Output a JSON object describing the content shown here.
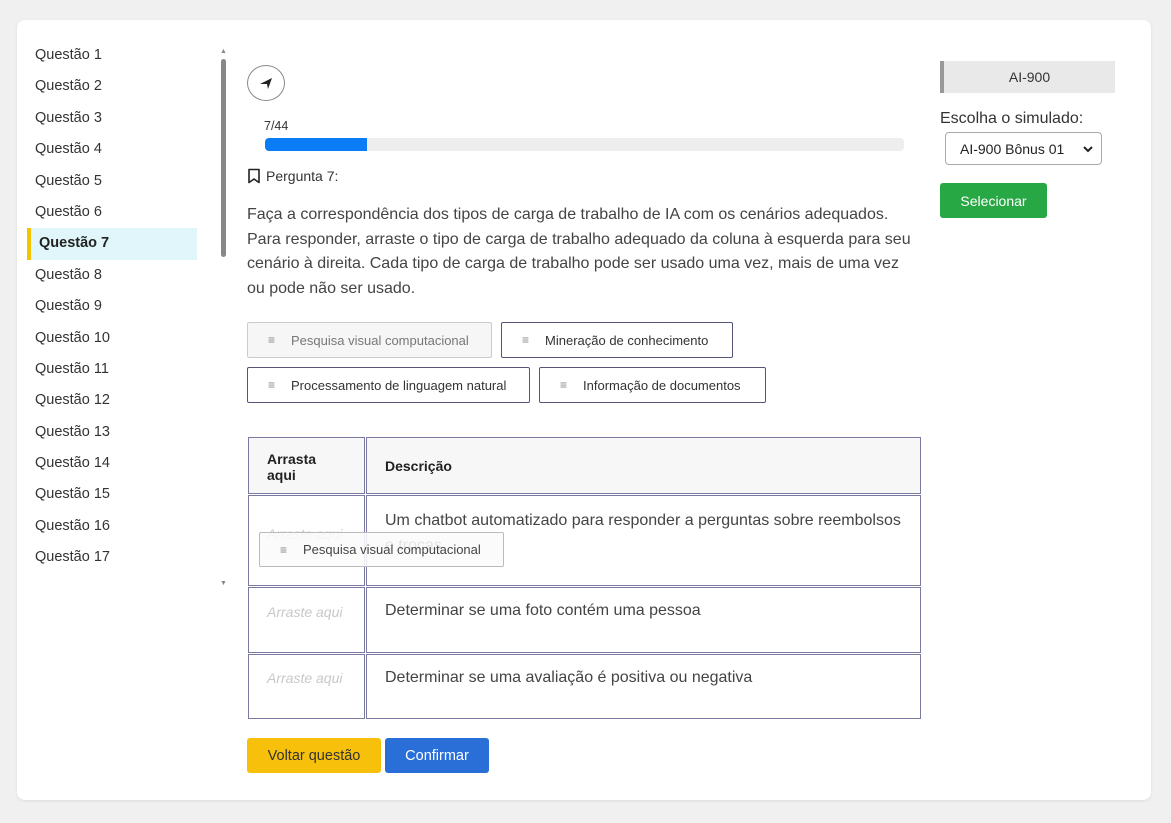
{
  "sidebar": {
    "items": [
      {
        "label": "Questão 1"
      },
      {
        "label": "Questão 2"
      },
      {
        "label": "Questão 3"
      },
      {
        "label": "Questão 4"
      },
      {
        "label": "Questão 5"
      },
      {
        "label": "Questão 6"
      },
      {
        "label": "Questão 7"
      },
      {
        "label": "Questão 8"
      },
      {
        "label": "Questão 9"
      },
      {
        "label": "Questão 10"
      },
      {
        "label": "Questão 11"
      },
      {
        "label": "Questão 12"
      },
      {
        "label": "Questão 13"
      },
      {
        "label": "Questão 14"
      },
      {
        "label": "Questão 15"
      },
      {
        "label": "Questão 16"
      },
      {
        "label": "Questão 17"
      }
    ],
    "active_index": 6
  },
  "progress": {
    "label": "7/44",
    "current": 7,
    "total": 44,
    "color": "#0a7cf5"
  },
  "question": {
    "title": "Pergunta 7:",
    "text": "Faça a correspondência dos tipos de carga de trabalho de IA com os cenários adequados. Para responder, arraste o tipo de carga de trabalho adequado da coluna à esquerda para seu cenário à direita. Cada tipo de carga de trabalho pode ser usado uma vez, mais de uma vez ou pode não ser usado."
  },
  "options": [
    {
      "label": "Pesquisa visual computacional"
    },
    {
      "label": "Mineração de conhecimento"
    },
    {
      "label": "Processamento de linguagem natural"
    },
    {
      "label": "Informação de documentos"
    }
  ],
  "dragging_chip": {
    "label": "Pesquisa visual computacional"
  },
  "table": {
    "header_drop": "Arrasta aqui",
    "header_desc": "Descrição",
    "drop_placeholder": "Arraste aqui",
    "rows": [
      {
        "description": "Um chatbot automatizado para responder a perguntas sobre reembolsos e trocas"
      },
      {
        "description": "Determinar se uma foto contém uma pessoa"
      },
      {
        "description": "Determinar se uma avaliação é positiva ou negativa"
      }
    ]
  },
  "buttons": {
    "back": "Voltar questão",
    "confirm": "Confirmar",
    "back_color": "#f7c00b",
    "confirm_color": "#2a6fd8"
  },
  "right_panel": {
    "exam": "AI-900",
    "choose_label": "Escolha o simulado:",
    "selected_exam": "AI-900 Bônus 01",
    "select_button": "Selecionar",
    "select_button_color": "#28a745"
  }
}
